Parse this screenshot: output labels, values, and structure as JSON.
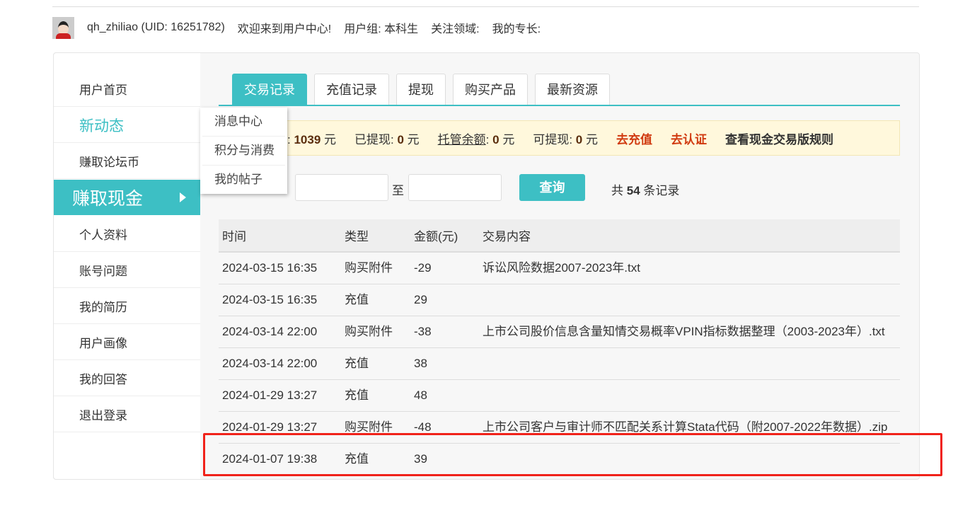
{
  "header": {
    "username": "qh_zhiliao (UID: 16251782)",
    "welcome": "欢迎来到用户中心!",
    "group": "用户组: 本科生",
    "focus": "关注领域:",
    "skills": "我的专长:"
  },
  "sidebar": {
    "items": [
      {
        "label": "用户首页"
      },
      {
        "label": "新动态"
      },
      {
        "label": "赚取论坛币"
      },
      {
        "label": "赚取现金"
      },
      {
        "label": "个人资料"
      },
      {
        "label": "账号问题"
      },
      {
        "label": "我的简历"
      },
      {
        "label": "用户画像"
      },
      {
        "label": "我的回答"
      },
      {
        "label": "退出登录"
      }
    ]
  },
  "dropdown": {
    "items": [
      "消息中心",
      "积分与消费",
      "我的帖子"
    ]
  },
  "tabs": [
    "交易记录",
    "充值记录",
    "提现",
    "购买产品",
    "最新资源"
  ],
  "balance": {
    "total_suffix": ": ",
    "total": "1039",
    "unit": " 元",
    "withdrawn_label": "已提现: ",
    "withdrawn": "0",
    "escrow_label": "托管余额",
    "escrow": "0",
    "available_label": "可提现: ",
    "available": "0",
    "recharge": "去充值",
    "verify": "去认证",
    "rules": "查看现金交易版规则"
  },
  "filter": {
    "to": "至",
    "query": "查询",
    "count_pre": "共 ",
    "count": "54",
    "count_post": " 条记录"
  },
  "table": {
    "headers": [
      "时间",
      "类型",
      "金额(元)",
      "交易内容"
    ],
    "rows": [
      [
        "2024-03-15 16:35",
        "购买附件",
        "-29",
        "诉讼风险数据2007-2023年.txt"
      ],
      [
        "2024-03-15 16:35",
        "充值",
        "29",
        ""
      ],
      [
        "2024-03-14 22:00",
        "购买附件",
        "-38",
        "上市公司股价信息含量知情交易概率VPIN指标数据整理（2003-2023年）.txt"
      ],
      [
        "2024-03-14 22:00",
        "充值",
        "38",
        ""
      ],
      [
        "2024-01-29 13:27",
        "充值",
        "48",
        ""
      ],
      [
        "2024-01-29 13:27",
        "购买附件",
        "-48",
        "上市公司客户与审计师不匹配关系计算Stata代码（附2007-2022年数据）.zip"
      ],
      [
        "2024-01-07 19:38",
        "充值",
        "39",
        ""
      ]
    ]
  }
}
